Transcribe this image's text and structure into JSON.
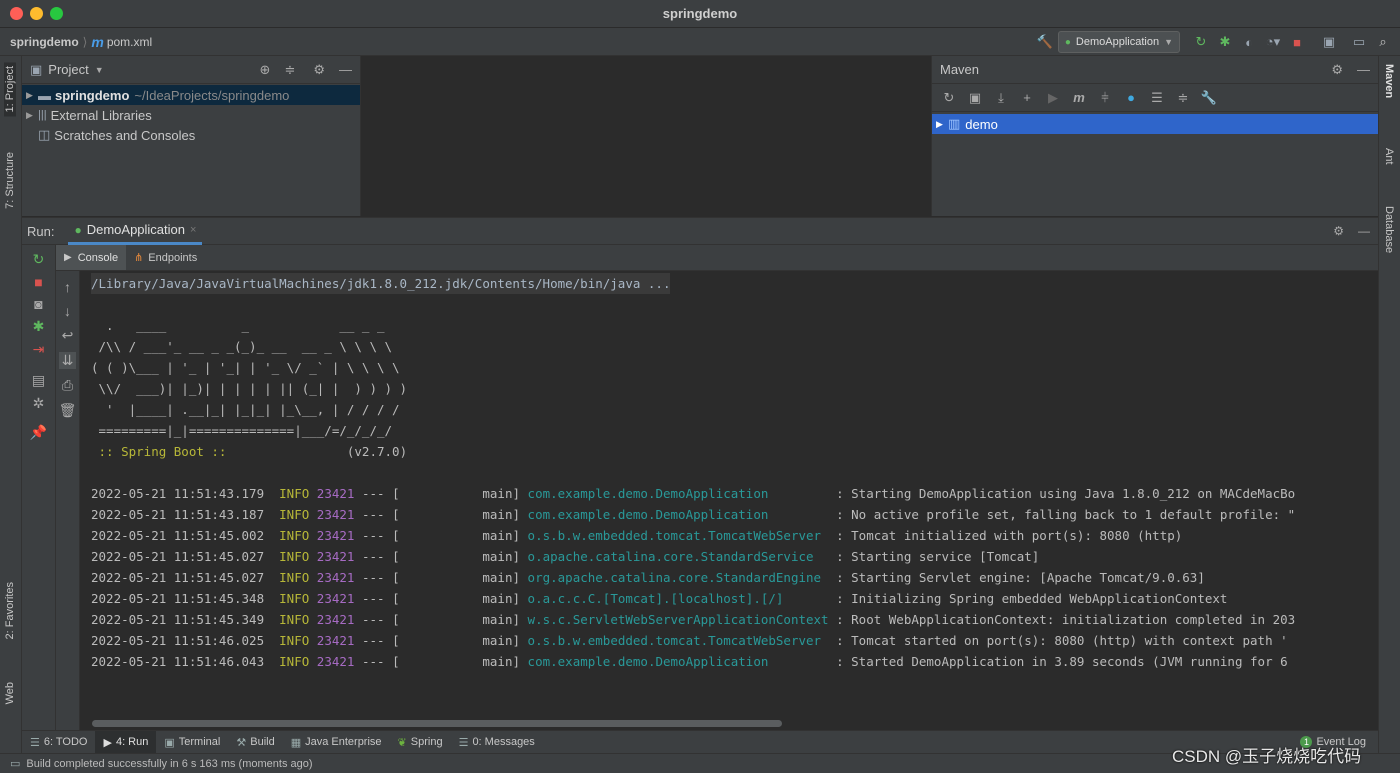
{
  "window": {
    "title": "springdemo"
  },
  "nav": {
    "project": "springdemo",
    "file": "pom.xml",
    "run_config": "DemoApplication"
  },
  "sidebar_left": {
    "project_tab": "1: Project",
    "structure_tab": "7: Structure",
    "favorites_tab": "2: Favorites",
    "web_tab": "Web"
  },
  "sidebar_right": {
    "maven_tab": "Maven",
    "ant_tab": "Ant",
    "database_tab": "Database"
  },
  "project_panel": {
    "title": "Project",
    "items": [
      {
        "name": "springdemo",
        "path": "~/IdeaProjects/springdemo"
      },
      {
        "name": "External Libraries"
      },
      {
        "name": "Scratches and Consoles"
      }
    ]
  },
  "maven_panel": {
    "title": "Maven",
    "items": [
      {
        "name": "demo"
      }
    ]
  },
  "run_panel": {
    "label": "Run:",
    "tab": "DemoApplication",
    "subtabs": [
      "Console",
      "Endpoints"
    ]
  },
  "console": {
    "command": "/Library/Java/JavaVirtualMachines/jdk1.8.0_212.jdk/Contents/Home/bin/java ...",
    "banner": [
      "  .   ____          _            __ _ _",
      " /\\\\ / ___'_ __ _ _(_)_ __  __ _ \\ \\ \\ \\",
      "( ( )\\___ | '_ | '_| | '_ \\/ _` | \\ \\ \\ \\",
      " \\\\/  ___)| |_)| | | | | || (_| |  ) ) ) )",
      "  '  |____| .__|_| |_|_| |_\\__, | / / / /",
      " =========|_|==============|___/=/_/_/_/"
    ],
    "spring_label": " :: Spring Boot :: ",
    "spring_version": "               (v2.7.0)",
    "logs": [
      {
        "ts": "2022-05-21 11:51:43.179",
        "level": "INFO",
        "pid": "23421",
        "thread": "--- [           main]",
        "logger": "com.example.demo.DemoApplication        ",
        "msg": " : Starting DemoApplication using Java 1.8.0_212 on MACdeMacBo"
      },
      {
        "ts": "2022-05-21 11:51:43.187",
        "level": "INFO",
        "pid": "23421",
        "thread": "--- [           main]",
        "logger": "com.example.demo.DemoApplication        ",
        "msg": " : No active profile set, falling back to 1 default profile: \""
      },
      {
        "ts": "2022-05-21 11:51:45.002",
        "level": "INFO",
        "pid": "23421",
        "thread": "--- [           main]",
        "logger": "o.s.b.w.embedded.tomcat.TomcatWebServer ",
        "msg": " : Tomcat initialized with port(s): 8080 (http)"
      },
      {
        "ts": "2022-05-21 11:51:45.027",
        "level": "INFO",
        "pid": "23421",
        "thread": "--- [           main]",
        "logger": "o.apache.catalina.core.StandardService  ",
        "msg": " : Starting service [Tomcat]"
      },
      {
        "ts": "2022-05-21 11:51:45.027",
        "level": "INFO",
        "pid": "23421",
        "thread": "--- [           main]",
        "logger": "org.apache.catalina.core.StandardEngine ",
        "msg": " : Starting Servlet engine: [Apache Tomcat/9.0.63]"
      },
      {
        "ts": "2022-05-21 11:51:45.348",
        "level": "INFO",
        "pid": "23421",
        "thread": "--- [           main]",
        "logger": "o.a.c.c.C.[Tomcat].[localhost].[/]      ",
        "msg": " : Initializing Spring embedded WebApplicationContext"
      },
      {
        "ts": "2022-05-21 11:51:45.349",
        "level": "INFO",
        "pid": "23421",
        "thread": "--- [           main]",
        "logger": "w.s.c.ServletWebServerApplicationContext",
        "msg": " : Root WebApplicationContext: initialization completed in 203"
      },
      {
        "ts": "2022-05-21 11:51:46.025",
        "level": "INFO",
        "pid": "23421",
        "thread": "--- [           main]",
        "logger": "o.s.b.w.embedded.tomcat.TomcatWebServer ",
        "msg": " : Tomcat started on port(s): 8080 (http) with context path '"
      },
      {
        "ts": "2022-05-21 11:51:46.043",
        "level": "INFO",
        "pid": "23421",
        "thread": "--- [           main]",
        "logger": "com.example.demo.DemoApplication        ",
        "msg": " : Started DemoApplication in 3.89 seconds (JVM running for 6"
      }
    ]
  },
  "bottom_tabs": [
    "6: TODO",
    "4: Run",
    "Terminal",
    "Build",
    "Java Enterprise",
    "Spring",
    "0: Messages"
  ],
  "event_log": {
    "count": "1",
    "label": "Event Log"
  },
  "status": {
    "message": "Build completed successfully in 6 s 163 ms (moments ago)"
  },
  "watermark": "CSDN @玉子烧烧吃代码",
  "colors": {
    "bg": "#2b2b2b",
    "panel": "#3c3f41",
    "selection": "#2f65ca",
    "info": "#b7b738",
    "pid": "#a66bc3",
    "logger": "#299999",
    "blue": "#4a9de8"
  }
}
